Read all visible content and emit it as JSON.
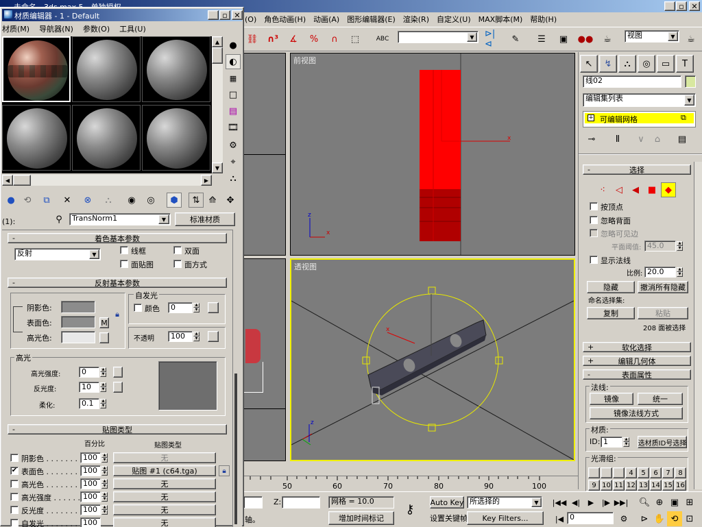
{
  "main": {
    "title": "未命名 - 3ds max 5 - 单独授权",
    "menus": [
      "(O)",
      "角色动画(H)",
      "动画(A)",
      "图形编辑器(E)",
      "渲染(R)",
      "自定义(U)",
      "MAX脚本(M)",
      "帮助(H)"
    ],
    "view_dropdown": "视图",
    "viewports": {
      "front": "前视图",
      "perspective": "透视图"
    },
    "ruler_ticks": [
      "50",
      "60",
      "70",
      "80",
      "90",
      "100"
    ],
    "status": {
      "z_label": "Z:",
      "grid": "网格 = 10.0",
      "auto_key": "Auto Key",
      "selected": "所选择的",
      "set_key": "设置关键帧",
      "key_filters": "Key Filters...",
      "add_time_tag": "增加时间标记",
      "hint": "轴。",
      "frame": "0"
    }
  },
  "cmd": {
    "object_name": "线02",
    "modifier_list": "编辑集列表",
    "stack_item": "可编辑网格",
    "select_header": "选择",
    "by_vertex": "按顶点",
    "ignore_backface": "忽略背面",
    "ignore_visible_edges": "忽略可见边",
    "planar_threshold_label": "平面阈值:",
    "planar_threshold": "45.0",
    "show_normals": "显示法线",
    "scale_label": "比例:",
    "scale": "20.0",
    "hide": "隐藏",
    "unhide_all": "撤消所有隐藏",
    "named_sel": "命名选择集:",
    "copy": "复制",
    "paste": "粘贴",
    "faces_selected": "208 面被选择",
    "soft_selection": "软化选择",
    "edit_geometry": "编辑几何体",
    "surface_props": "表面属性",
    "normals_label": "法线:",
    "flip": "镜像",
    "unify": "统一",
    "flip_normal_mode": "镜像法线方式",
    "material_label": "材质:",
    "id_label": "ID:",
    "id_value": "1",
    "select_by_id": "选材质ID号选择",
    "smoothing_label": "光滑组:",
    "smoothing_row1": [
      "",
      "",
      "",
      "4",
      "5",
      "6",
      "7",
      "8"
    ],
    "smoothing_row2": [
      "9",
      "10",
      "11",
      "12",
      "13",
      "14",
      "15",
      "16"
    ]
  },
  "mat": {
    "title": "材质编辑器 - 1 - Default",
    "menus": [
      "材质(M)",
      "导航器(N)",
      "参数(O)",
      "工具(U)"
    ],
    "slot_label": "(1):",
    "mat_name": "TransNorm1",
    "mat_type": "标准材质",
    "shader_basic": "着色基本参数",
    "shader_type": "反射",
    "wire": "线框",
    "two_sided": "双面",
    "face_map": "面贴图",
    "faceted": "面方式",
    "reflect_basic": "反射基本参数",
    "ambient": "阴影色:",
    "diffuse": "表面色:",
    "specular_color": "高光色:",
    "m_button": "M",
    "self_illum": "自发光",
    "color_label": "颜色",
    "color_value": "0",
    "opacity_label": "不透明",
    "opacity_value": "100",
    "highlight": "高光",
    "spec_level": "高光强度:",
    "spec_level_value": "0",
    "glossiness": "反光度:",
    "glossiness_value": "10",
    "soften": "柔化:",
    "soften_value": "0.1",
    "map_types": "贴图类型",
    "amount_hdr": "百分比",
    "maptype_hdr": "贴图类型",
    "maps": [
      {
        "name": "阴影色 . . . . . . .",
        "amount": "100",
        "map": "无",
        "checked": ""
      },
      {
        "name": "表面色 . . . . . . .",
        "amount": "100",
        "map": "贴图 #1 (c64.tga)",
        "checked": "✔"
      },
      {
        "name": "高光色 . . . . . . .",
        "amount": "100",
        "map": "无",
        "checked": ""
      },
      {
        "name": "高光强度 . . . . . .",
        "amount": "100",
        "map": "无",
        "checked": ""
      },
      {
        "name": "反光度 . . . . . . .",
        "amount": "100",
        "map": "无",
        "checked": ""
      },
      {
        "name": "自发光 . . . . . . .",
        "amount": "100",
        "map": "无",
        "checked": ""
      }
    ]
  }
}
